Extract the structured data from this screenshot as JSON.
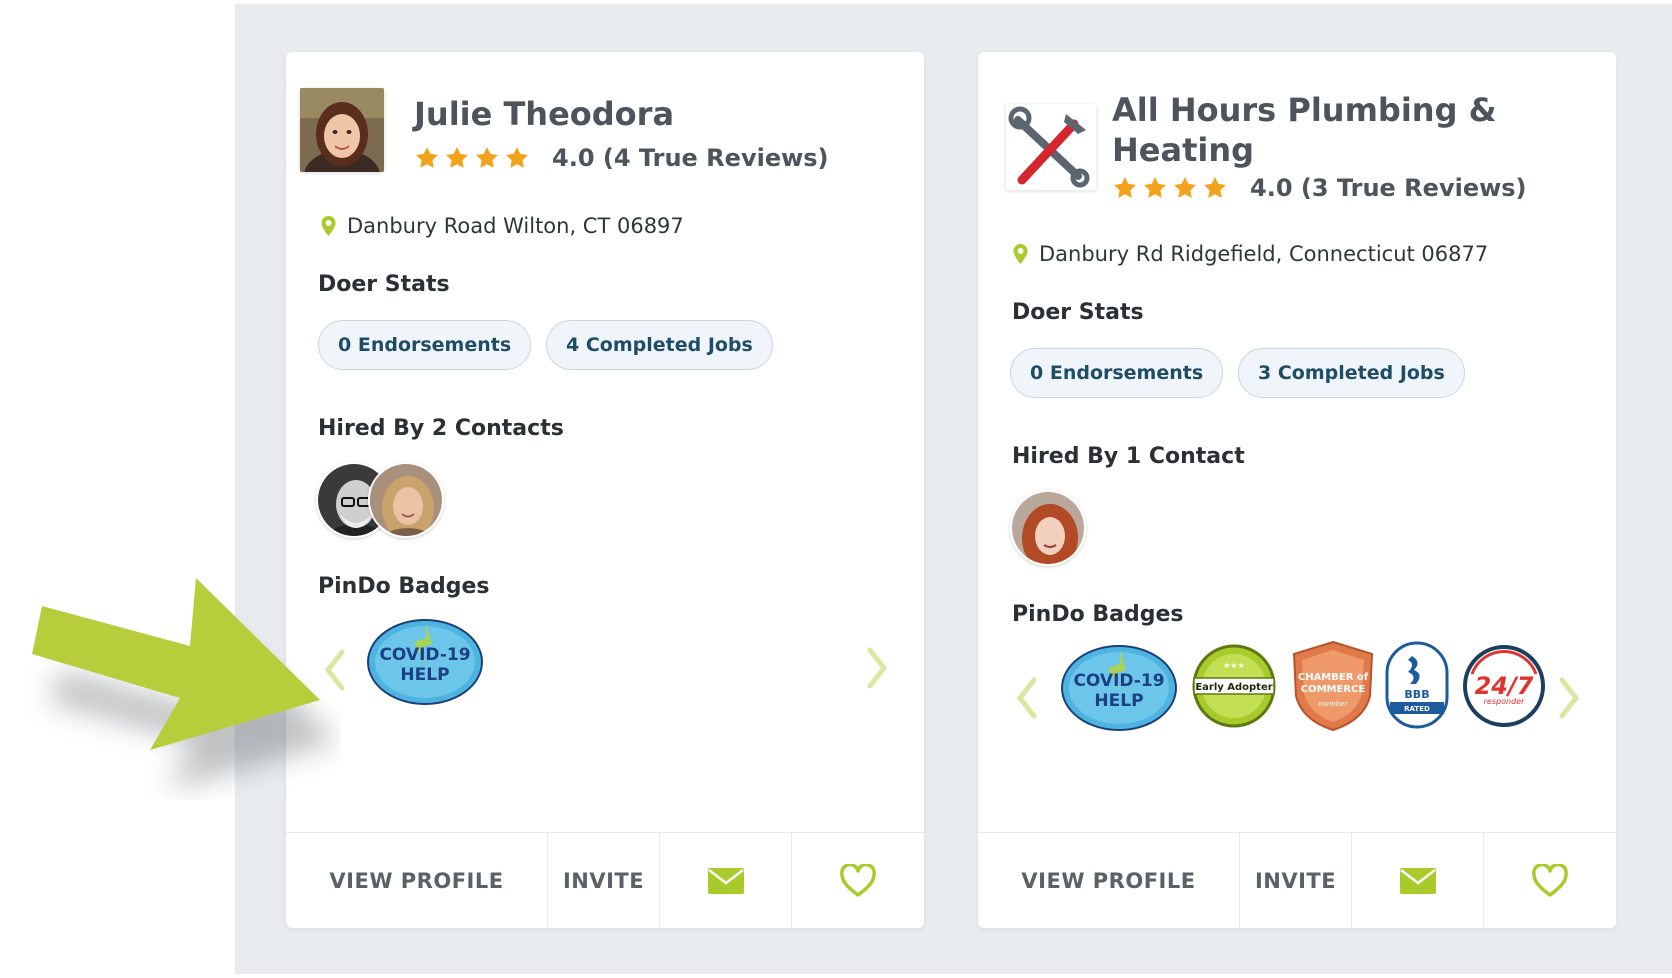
{
  "colors": {
    "accent_green": "#a8cb2b",
    "star_orange": "#f2a31b",
    "pill_text": "#1f4d68",
    "panel_bg": "#e8ecef"
  },
  "cards": [
    {
      "name": "Julie Theodora",
      "avatar_icon": "person-photo-icon",
      "rating": 4.0,
      "rating_text": "4.0 (4 True Reviews)",
      "location": "Danbury Road Wilton, CT 06897",
      "doer_stats_title": "Doer Stats",
      "endorsements": "0 Endorsements",
      "completed_jobs": "4 Completed Jobs",
      "hired_by": "Hired By 2 Contacts",
      "badges_title": "PinDo Badges",
      "badges": [
        {
          "icon": "covid-19-help-badge-icon",
          "line1": "COVID-19",
          "line2": "HELP"
        }
      ],
      "footer": {
        "view_profile": "VIEW PROFILE",
        "invite": "INVITE",
        "mail_icon": "envelope-icon",
        "fav_icon": "heart-icon"
      }
    },
    {
      "name_line1": "All Hours Plumbing &",
      "name_line2": "Heating",
      "avatar_icon": "wrench-logo-icon",
      "rating": 4.0,
      "rating_text": "4.0 (3 True Reviews)",
      "location": "Danbury Rd Ridgefield, Connecticut 06877",
      "doer_stats_title": "Doer Stats",
      "endorsements": "0 Endorsements",
      "completed_jobs": "3 Completed Jobs",
      "hired_by": "Hired By 1 Contact",
      "badges_title": "PinDo Badges",
      "badges": [
        {
          "icon": "covid-19-help-badge-icon",
          "line1": "COVID-19",
          "line2": "HELP"
        },
        {
          "icon": "early-adopter-badge-icon",
          "label": "Early Adopter"
        },
        {
          "icon": "chamber-of-commerce-badge-icon",
          "line1": "CHAMBER of",
          "line2": "COMMERCE",
          "small": "member"
        },
        {
          "icon": "bbb-rated-badge-icon",
          "line1": "BBB",
          "line2": "RATED"
        },
        {
          "icon": "24-7-responder-badge-icon",
          "big": "24/7",
          "small": "responder"
        }
      ],
      "footer": {
        "view_profile": "VIEW PROFILE",
        "invite": "INVITE",
        "mail_icon": "envelope-icon",
        "fav_icon": "heart-icon"
      }
    }
  ]
}
